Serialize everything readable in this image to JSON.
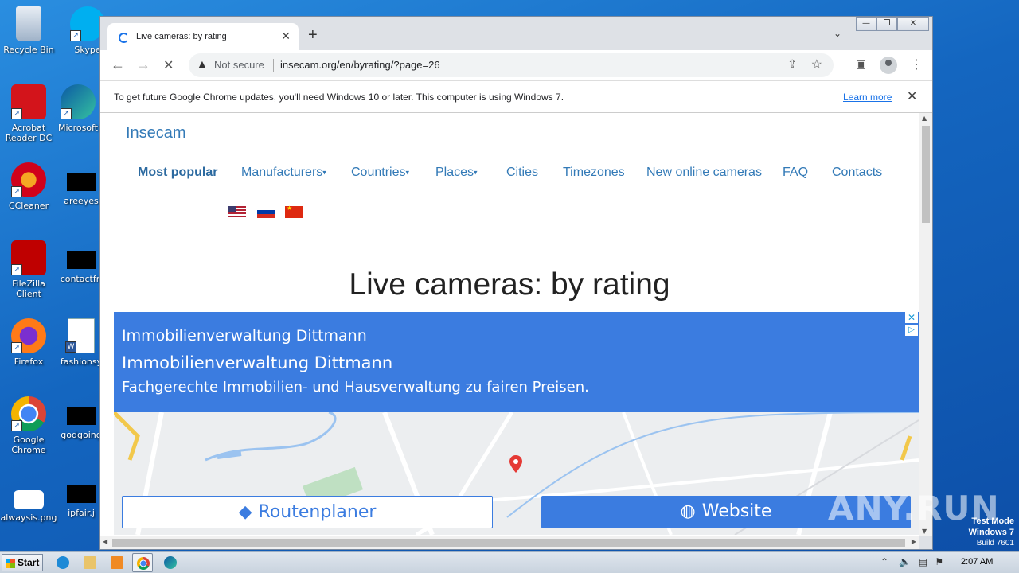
{
  "desktop": {
    "icons": [
      {
        "label": "Recycle Bin"
      },
      {
        "label": "Skype"
      },
      {
        "label": "Acrobat Reader DC"
      },
      {
        "label": "Microsoft"
      },
      {
        "label": "CCleaner"
      },
      {
        "label": "areeyes"
      },
      {
        "label": "FileZilla Client"
      },
      {
        "label": "contactfri"
      },
      {
        "label": "Firefox"
      },
      {
        "label": "fashionsy"
      },
      {
        "label": "Google Chrome"
      },
      {
        "label": "godgoing"
      },
      {
        "label": "alwaysis.png"
      },
      {
        "label": "ipfair.j"
      }
    ]
  },
  "browser": {
    "tab": {
      "title": "Live cameras: by rating",
      "close": "✕"
    },
    "new_tab": "+",
    "tab_menu": "⌄",
    "window_controls": {
      "minimize": "—",
      "restore": "❐",
      "close": "✕"
    },
    "toolbar": {
      "back": "←",
      "forward": "→",
      "reload": "✕",
      "security_label": "Not secure",
      "url": "insecam.org/en/byrating/?page=26",
      "share": "⇪",
      "star": "☆",
      "sidepanel": "▣",
      "menu": "⋮"
    },
    "infobar": {
      "message": "To get future Google Chrome updates, you'll need Windows 10 or later. This computer is using Windows 7.",
      "learn_more": "Learn more",
      "close": "✕"
    }
  },
  "page": {
    "brand": "Insecam",
    "nav": [
      {
        "label": "Most popular",
        "dropdown": false
      },
      {
        "label": "Manufacturers",
        "dropdown": true
      },
      {
        "label": "Countries",
        "dropdown": true
      },
      {
        "label": "Places",
        "dropdown": true
      },
      {
        "label": "Cities",
        "dropdown": false
      },
      {
        "label": "Timezones",
        "dropdown": false
      },
      {
        "label": "New online cameras",
        "dropdown": false
      },
      {
        "label": "FAQ",
        "dropdown": false
      },
      {
        "label": "Contacts",
        "dropdown": false
      }
    ],
    "caret": "▾",
    "heading": "Live cameras: by rating",
    "ad": {
      "line1": "Immobilienverwaltung Dittmann",
      "line2": "Immobilienverwaltung Dittmann",
      "line3": "Fachgerechte Immobilien- und Hausverwaltung zu fairen Preisen.",
      "close": "✕",
      "info": "▷",
      "route_button": "Routenplaner",
      "website_button": "Website"
    }
  },
  "watermark": "ANY.RUN",
  "system": {
    "test_mode": "Test Mode",
    "os": "Windows 7",
    "build": "Build 7601",
    "start_label": "Start",
    "clock": "2:07 AM"
  },
  "colors": {
    "link": "#337ab7",
    "ad_blue": "#3b7ce0",
    "desktop": "#1466c0"
  }
}
